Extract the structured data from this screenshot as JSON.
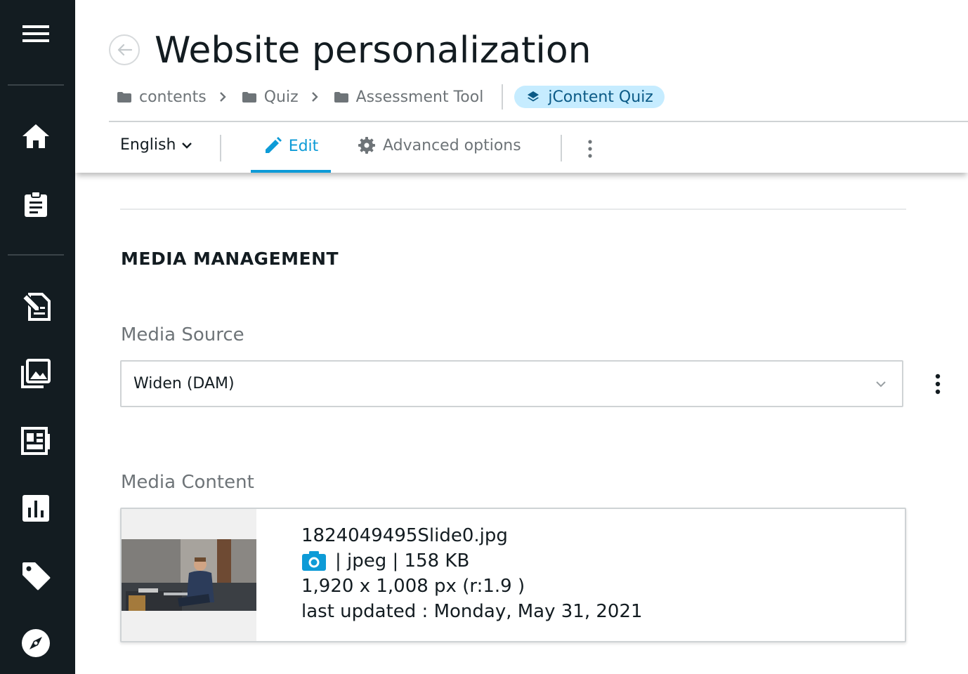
{
  "page": {
    "title": "Website personalization"
  },
  "breadcrumb": {
    "items": [
      "contents",
      "Quiz",
      "Assessment Tool"
    ],
    "chip_label": "jContent Quiz"
  },
  "toolbar": {
    "language": "English",
    "edit_tab": "Edit",
    "advanced_tab": "Advanced options"
  },
  "section": {
    "title": "MEDIA MANAGEMENT"
  },
  "media_source": {
    "label": "Media Source",
    "value": "Widen (DAM)"
  },
  "media_content": {
    "label": "Media Content",
    "filename": "1824049495Slide0.jpg",
    "type_size": "| jpeg | 158 KB",
    "dimensions": "1,920 x 1,008 px (r:1.9 )",
    "updated": "last updated : Monday, May 31, 2021"
  },
  "colors": {
    "nav_bg": "#131c21",
    "accent": "#0d9bd7",
    "chip_bg": "#c6ecff"
  },
  "icons": {
    "nav": [
      "menu-icon",
      "home-icon",
      "clipboard-icon",
      "edit-page-icon",
      "media-library-icon",
      "dashboard-icon",
      "analytics-icon",
      "tag-icon",
      "compass-icon"
    ]
  }
}
